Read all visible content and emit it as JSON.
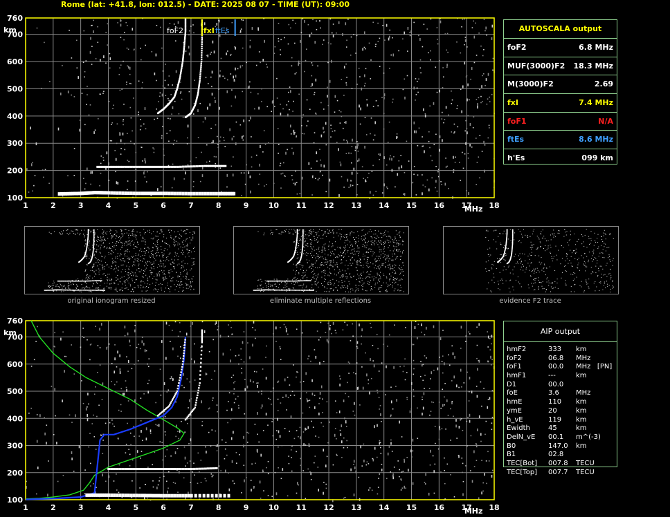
{
  "header": "Rome (lat: +41.8, lon: 012.5) - DATE: 2025 08 07 - TIME (UT): 09:00",
  "colors": {
    "frame": "#ffff00",
    "grid": "#8a8a8a",
    "panel_border": "#8fd18f",
    "foF2": "#ffffff",
    "fxI": "#ffff00",
    "foF1": "#ff2020",
    "ftEs": "#3fa0ff",
    "profile_green": "#22dd22",
    "profile_blue": "#1a3cff"
  },
  "axis": {
    "km_label": "km",
    "mhz_label": "MHz",
    "yticks": [
      "760",
      "700",
      "600",
      "500",
      "400",
      "300",
      "200",
      "100"
    ],
    "xticks": [
      "1",
      "2",
      "3",
      "4",
      "5",
      "6",
      "7",
      "8",
      "9",
      "10",
      "11",
      "12",
      "13",
      "14",
      "15",
      "16",
      "17",
      "18"
    ]
  },
  "markers": {
    "foF2": "foF2",
    "fxI": "fxI",
    "ftEs": "ftEs"
  },
  "autoscala": {
    "title": "AUTOSCALA output",
    "rows": [
      {
        "param": "foF2",
        "value": "6.8 MHz",
        "color": "#ffffff"
      },
      {
        "param": "MUF(3000)F2",
        "value": "18.3 MHz",
        "color": "#ffffff"
      },
      {
        "param": "M(3000)F2",
        "value": "2.69",
        "color": "#ffffff"
      },
      {
        "param": "fxI",
        "value": "7.4 MHz",
        "color": "#ffff00"
      },
      {
        "param": "foF1",
        "value": "N/A",
        "color": "#ff2020"
      },
      {
        "param": "ftEs",
        "value": "8.6 MHz",
        "color": "#3fa0ff"
      },
      {
        "param": "h'Es",
        "value": "099    km",
        "color": "#ffffff"
      }
    ]
  },
  "thumbs": [
    {
      "caption": "original ionogram resized"
    },
    {
      "caption": "eliminate multiple reflections"
    },
    {
      "caption": "evidence F2 trace"
    }
  ],
  "aip": {
    "title": "AIP output",
    "rows": [
      {
        "p": "hmF2",
        "v": "333",
        "u": "km"
      },
      {
        "p": "foF2",
        "v": "06.8",
        "u": "MHz"
      },
      {
        "p": "foF1",
        "v": "00.0",
        "u": "MHz   [PN]"
      },
      {
        "p": "hmF1",
        "v": "---",
        "u": "km"
      },
      {
        "p": "D1",
        "v": "00.0",
        "u": ""
      },
      {
        "p": "foE",
        "v": "3.6",
        "u": "MHz"
      },
      {
        "p": "hmE",
        "v": "110",
        "u": "km"
      },
      {
        "p": "ymE",
        "v": "20",
        "u": "km"
      },
      {
        "p": "h_vE",
        "v": "119",
        "u": "km"
      },
      {
        "p": "Ewidth",
        "v": "45",
        "u": "km"
      },
      {
        "p": "DelN_vE",
        "v": "00.1",
        "u": "m^(-3)"
      },
      {
        "p": "B0",
        "v": "147.0",
        "u": "km"
      },
      {
        "p": "B1",
        "v": "02.8",
        "u": ""
      },
      {
        "p": "TEC[Bot]",
        "v": "007.8",
        "u": "TECU"
      },
      {
        "p": "TEC[Top]",
        "v": "007.7",
        "u": "TECU"
      }
    ]
  },
  "chart_data": [
    {
      "type": "scatter",
      "title": "",
      "xlabel": "MHz",
      "ylabel": "km",
      "xlim": [
        1,
        18
      ],
      "ylim": [
        100,
        760
      ],
      "grid": true,
      "series": [
        {
          "name": "foF2",
          "color": "#ffffff",
          "points": [
            [
              5.8,
              410
            ],
            [
              6.0,
              425
            ],
            [
              6.2,
              445
            ],
            [
              6.4,
              470
            ],
            [
              6.5,
              500
            ],
            [
              6.6,
              540
            ],
            [
              6.7,
              600
            ],
            [
              6.75,
              650
            ],
            [
              6.8,
              710
            ],
            [
              6.8,
              760
            ]
          ]
        },
        {
          "name": "fxI",
          "color": "#ffffff",
          "points": [
            [
              6.8,
              395
            ],
            [
              7.0,
              410
            ],
            [
              7.15,
              440
            ],
            [
              7.25,
              480
            ],
            [
              7.32,
              530
            ],
            [
              7.38,
              600
            ],
            [
              7.4,
              680
            ],
            [
              7.4,
              760
            ]
          ]
        },
        {
          "name": "",
          "color": "#ffffff",
          "points": [
            [
              3.6,
              212
            ],
            [
              4.5,
              212
            ],
            [
              5.5,
              212
            ],
            [
              6.5,
              212
            ],
            [
              7.5,
              215
            ],
            [
              8.3,
              215
            ]
          ]
        },
        {
          "name": "",
          "color": "#ffffff",
          "points": [
            [
              2.2,
              115
            ],
            [
              3.0,
              117
            ],
            [
              3.5,
              120
            ],
            [
              4.0,
              119
            ],
            [
              5.0,
              117
            ],
            [
              6.0,
              117
            ],
            [
              7.0,
              116
            ],
            [
              8.0,
              116
            ],
            [
              8.6,
              116
            ]
          ]
        }
      ],
      "vlines": [
        {
          "x": 6.8,
          "color": "#ffffff",
          "label": "foF2"
        },
        {
          "x": 7.4,
          "color": "#ffff00",
          "label": "fxI"
        },
        {
          "x": 8.6,
          "color": "#3fa0ff",
          "label": "ftEs"
        }
      ]
    },
    {
      "type": "line",
      "title": "",
      "xlabel": "MHz",
      "ylabel": "km",
      "xlim": [
        1,
        18
      ],
      "ylim": [
        100,
        760
      ],
      "grid": true,
      "series": [
        {
          "name": "",
          "color": "#22dd22",
          "points": [
            [
              1.2,
              760
            ],
            [
              1.5,
              700
            ],
            [
              2.0,
              640
            ],
            [
              2.6,
              590
            ],
            [
              3.2,
              550
            ],
            [
              4.0,
              510
            ],
            [
              4.8,
              470
            ],
            [
              5.4,
              430
            ],
            [
              6.0,
              395
            ],
            [
              6.5,
              365
            ],
            [
              6.75,
              345
            ],
            [
              6.6,
              320
            ],
            [
              6.0,
              290
            ],
            [
              5.0,
              255
            ],
            [
              4.0,
              220
            ],
            [
              3.5,
              190
            ],
            [
              3.3,
              160
            ],
            [
              3.1,
              135
            ],
            [
              2.6,
              118
            ],
            [
              2.0,
              110
            ],
            [
              1.5,
              105
            ],
            [
              1.0,
              103
            ]
          ]
        },
        {
          "name": "",
          "color": "#1a3cff",
          "points": [
            [
              1.0,
              101
            ],
            [
              2.0,
              104
            ],
            [
              3.0,
              110
            ],
            [
              3.5,
              125
            ],
            [
              3.7,
              320
            ],
            [
              3.85,
              340
            ],
            [
              4.2,
              340
            ],
            [
              4.8,
              360
            ],
            [
              5.4,
              385
            ],
            [
              6.0,
              410
            ],
            [
              6.3,
              440
            ],
            [
              6.5,
              480
            ],
            [
              6.65,
              550
            ],
            [
              6.75,
              620
            ],
            [
              6.8,
              700
            ]
          ]
        },
        {
          "name": "",
          "color": "#ffffff",
          "points": [
            [
              5.8,
              410
            ],
            [
              6.2,
              445
            ],
            [
              6.5,
              500
            ],
            [
              6.7,
              600
            ],
            [
              6.8,
              700
            ]
          ]
        },
        {
          "name": "",
          "color": "#ffffff",
          "points": [
            [
              6.8,
              395
            ],
            [
              7.15,
              440
            ],
            [
              7.32,
              530
            ],
            [
              7.4,
              680
            ],
            [
              7.4,
              730
            ]
          ]
        },
        {
          "name": "",
          "color": "#ffffff",
          "points": [
            [
              4.0,
              212
            ],
            [
              5.0,
              212
            ],
            [
              6.0,
              212
            ],
            [
              7.0,
              212
            ],
            [
              8.0,
              215
            ]
          ]
        },
        {
          "name": "",
          "color": "#ffffff",
          "points": [
            [
              3.2,
              118
            ],
            [
              4.0,
              118
            ],
            [
              5.0,
              117
            ],
            [
              6.0,
              116
            ],
            [
              7.0,
              116
            ],
            [
              8.5,
              116
            ]
          ]
        }
      ]
    }
  ]
}
